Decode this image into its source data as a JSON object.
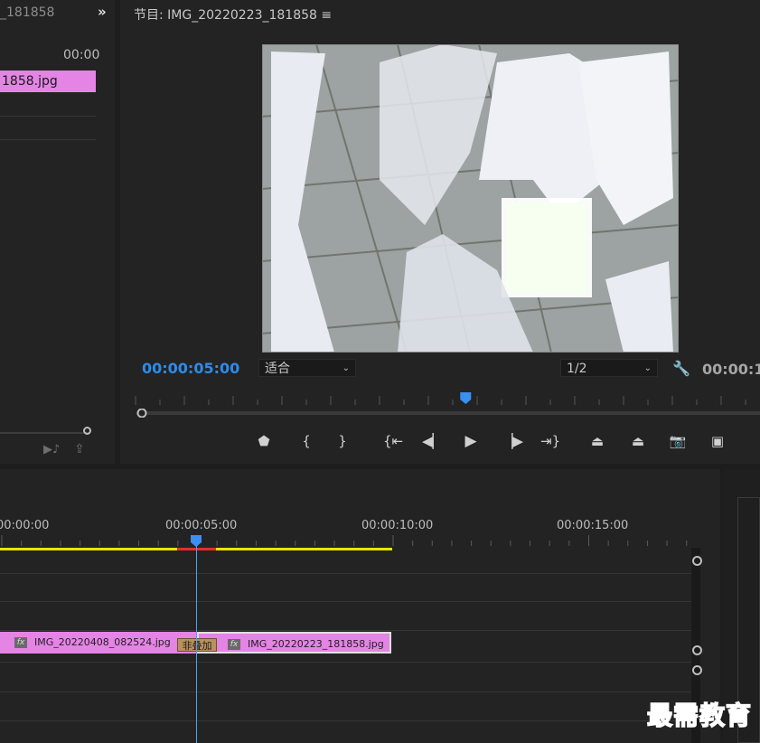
{
  "source_panel": {
    "tab_title": "_181858",
    "overflow_label": "»",
    "timecode": "00:00",
    "clip_label": "1858.jpg"
  },
  "program_monitor": {
    "title": "节目: IMG_20220223_181858",
    "menu_icon": "≡",
    "current_time": "00:00:05:00",
    "zoom": {
      "selected": "适合"
    },
    "resolution": {
      "selected": "1/2"
    },
    "duration": "00:00:1",
    "playhead_fraction": 0.53,
    "transport_icons": [
      "marker-icon",
      "mark-in-icon",
      "mark-out-icon",
      "go-to-in-icon",
      "step-back-icon",
      "play-icon",
      "step-forward-icon",
      "go-to-out-icon",
      "lift-icon",
      "extract-icon",
      "camera-icon",
      "compare-icon"
    ]
  },
  "timeline": {
    "time_labels": [
      "00:00:00",
      "00:00:05:00",
      "00:00:10:00",
      "00:00:15:00"
    ],
    "clips": [
      {
        "fx": "fx",
        "label": "IMG_20220408_082524.jpg"
      },
      {
        "fx": "fx",
        "label": "IMG_20220223_181858.jpg"
      }
    ],
    "transition_label": "非叠加"
  },
  "watermark": "最需教育",
  "colors": {
    "accent": "#2d8ceb",
    "clip": "#e484e4",
    "work_area": "#e6e600",
    "render_red": "#e0302b"
  }
}
